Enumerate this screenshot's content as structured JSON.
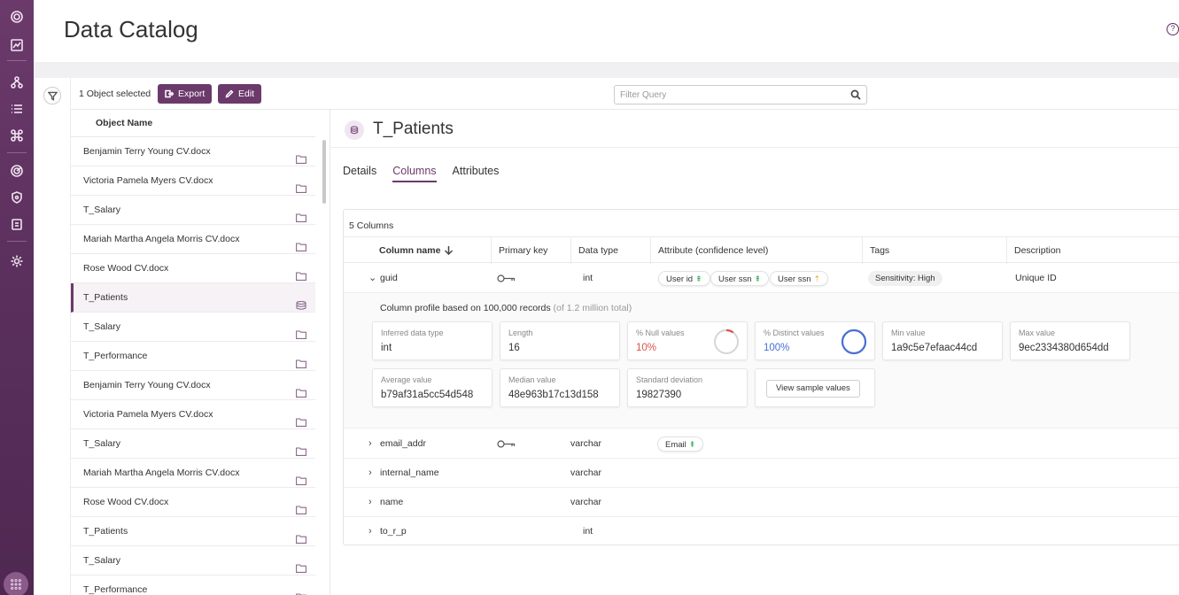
{
  "header": {
    "title": "Data Catalog"
  },
  "toolbar": {
    "selection": "1 Object selected",
    "export_label": "Export",
    "edit_label": "Edit",
    "search_placeholder": "Filter Query"
  },
  "object_list": {
    "header": "Object Name",
    "items": [
      {
        "name": "Benjamin Terry Young CV.docx",
        "icon": "folder-icon"
      },
      {
        "name": "Victoria Pamela Myers CV.docx",
        "icon": "folder-icon"
      },
      {
        "name": "T_Salary",
        "icon": "folder-icon"
      },
      {
        "name": "Mariah Martha Angela Morris CV.docx",
        "icon": "folder-icon"
      },
      {
        "name": "Rose Wood CV.docx",
        "icon": "folder-icon"
      },
      {
        "name": "T_Patients",
        "icon": "database-icon",
        "selected": true
      },
      {
        "name": "T_Salary",
        "icon": "folder-icon"
      },
      {
        "name": "T_Performance",
        "icon": "folder-icon"
      },
      {
        "name": "Benjamin Terry Young CV.docx",
        "icon": "folder-icon"
      },
      {
        "name": "Victoria Pamela Myers CV.docx",
        "icon": "folder-icon"
      },
      {
        "name": "T_Salary",
        "icon": "folder-icon"
      },
      {
        "name": "Mariah Martha Angela Morris CV.docx",
        "icon": "folder-icon"
      },
      {
        "name": "Rose Wood CV.docx",
        "icon": "folder-icon"
      },
      {
        "name": "T_Patients",
        "icon": "folder-icon"
      },
      {
        "name": "T_Salary",
        "icon": "folder-icon"
      },
      {
        "name": "T_Performance",
        "icon": "folder-icon"
      }
    ]
  },
  "detail": {
    "title": "T_Patients",
    "tabs": [
      "Details",
      "Columns",
      "Attributes"
    ],
    "active_tab": "Columns",
    "column_count": "5 Columns",
    "headers": [
      "Column name",
      "Primary key",
      "Data type",
      "Attribute (confidence level)",
      "Tags",
      "Description"
    ],
    "rows": [
      {
        "name": "guid",
        "primary_key": true,
        "type": "int",
        "attributes": [
          "User id",
          "User ssn",
          "User ssn"
        ],
        "tag": "Sensitivity: High",
        "description": "Unique ID",
        "expanded": true
      },
      {
        "name": "email_addr",
        "primary_key": true,
        "type": "varchar",
        "attributes": [
          "Email"
        ],
        "tag": "",
        "description": ""
      },
      {
        "name": "internal_name",
        "primary_key": false,
        "type": "varchar",
        "attributes": [],
        "tag": "",
        "description": ""
      },
      {
        "name": "name",
        "primary_key": false,
        "type": "varchar",
        "attributes": [],
        "tag": "",
        "description": ""
      },
      {
        "name": "to_r_p",
        "primary_key": false,
        "type": "int",
        "attributes": [],
        "tag": "",
        "description": ""
      }
    ],
    "profile": {
      "caption": "Column profile based on 100,000 records",
      "caption_muted": "(of 1.2 million total)",
      "stats": [
        {
          "label": "Inferred data type",
          "value": "int"
        },
        {
          "label": "Length",
          "value": "16"
        },
        {
          "label": "% Null values",
          "value": "10%"
        },
        {
          "label": "% Distinct values",
          "value": "100%"
        },
        {
          "label": "Min value",
          "value": "1a9c5e7efaac44cd"
        },
        {
          "label": "Max value",
          "value": "9ec2334380d654dd"
        },
        {
          "label": "Average value",
          "value": "b79af31a5cc54d548"
        },
        {
          "label": "Median value",
          "value": "48e963b17c13d158"
        },
        {
          "label": "Standard deviation",
          "value": "19827390"
        }
      ],
      "null_fraction": 0.1,
      "distinct_fraction": 1.0,
      "sample_button": "View sample values"
    }
  },
  "colors": {
    "brand": "#6b3a6b",
    "null_ring": "#d9534f",
    "distinct_ring": "#4a6fd6",
    "confidence_high": "#2fa84f",
    "confidence_medium": "#e5a22a"
  }
}
